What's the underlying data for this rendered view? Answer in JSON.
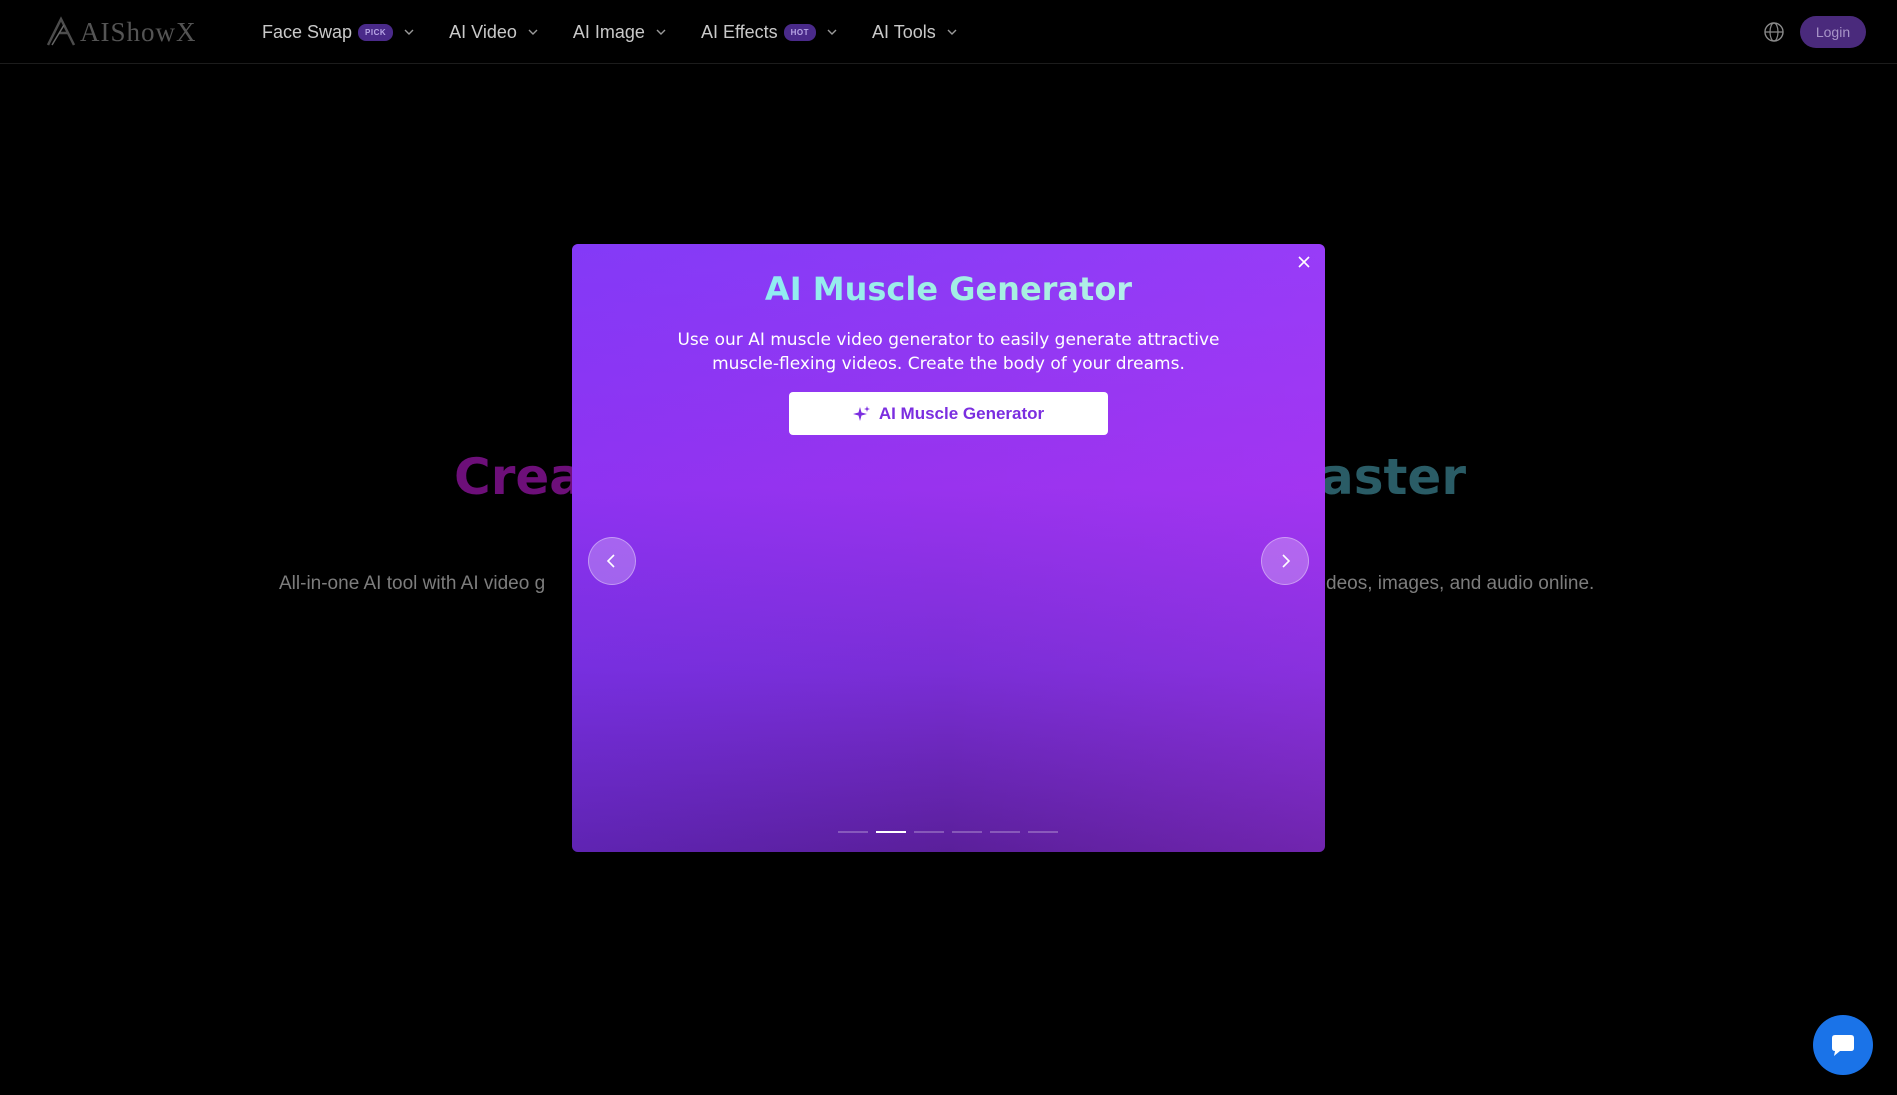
{
  "header": {
    "logo_text": "AIShowX",
    "nav": [
      {
        "label": "Face Swap",
        "badge": "PICK"
      },
      {
        "label": "AI Video",
        "badge": ""
      },
      {
        "label": "AI Image",
        "badge": ""
      },
      {
        "label": "AI Effects",
        "badge": "HOT"
      },
      {
        "label": "AI Tools",
        "badge": ""
      }
    ],
    "login_label": "Login"
  },
  "hero": {
    "title_left": "Crea",
    "title_right": "aster",
    "subtitle_left": "All-in-one AI tool with AI video g",
    "subtitle_right": "deos, images, and audio online."
  },
  "modal": {
    "title": "AI Muscle Generator",
    "description": "Use our AI muscle video generator to easily generate attractive muscle-flexing videos. Create the body of your dreams.",
    "cta_label": "AI Muscle Generator",
    "slide_count": 6,
    "active_slide": 2
  },
  "colors": {
    "accent": "#7b2ee0",
    "modal_top": "#8b3cf6",
    "modal_bottom": "#5a1f9a",
    "chat": "#1a73e8"
  }
}
